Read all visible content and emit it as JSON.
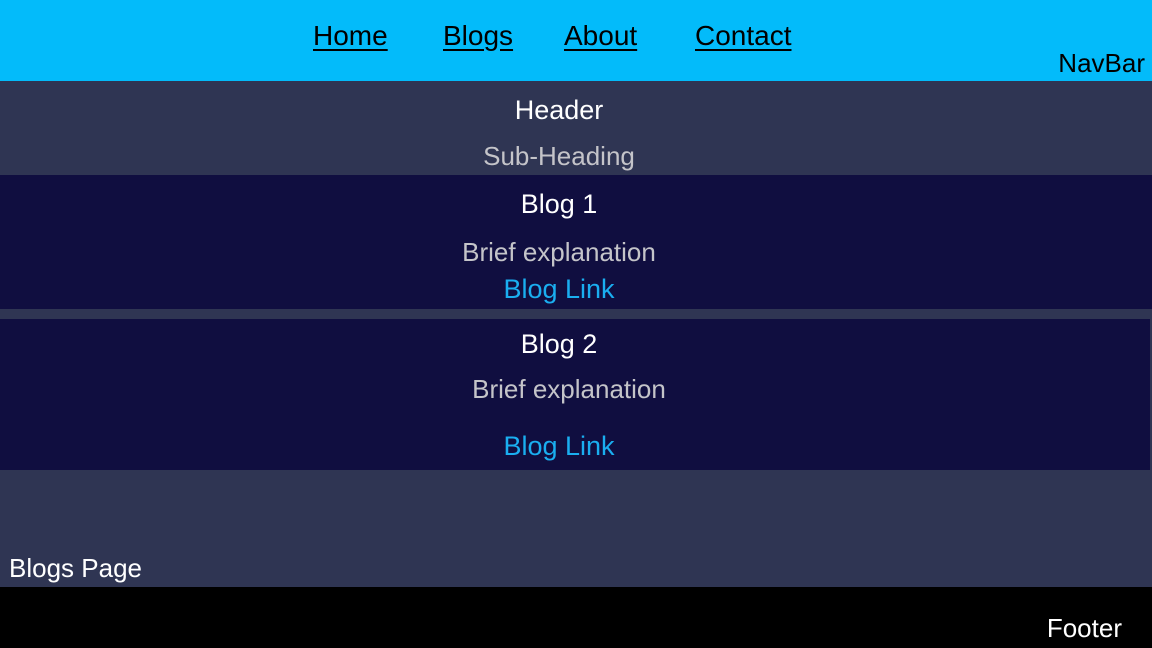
{
  "navbar": {
    "links": [
      "Home",
      "Blogs",
      "About",
      "Contact"
    ],
    "caption": "NavBar"
  },
  "header": {
    "title": "Header",
    "subtitle": "Sub-Heading"
  },
  "blogs": [
    {
      "title": "Blog 1",
      "description": "Brief explanation",
      "link": "Blog Link"
    },
    {
      "title": "Blog 2",
      "description": "Brief explanation",
      "link": "Blog Link"
    }
  ],
  "page_caption": "Blogs Page",
  "footer": {
    "caption": "Footer"
  },
  "colors": {
    "navbar": "#03bbfa",
    "page_background": "#2f3553",
    "card_background": "#100e40",
    "link": "#1aaef0",
    "footer": "#000000"
  }
}
